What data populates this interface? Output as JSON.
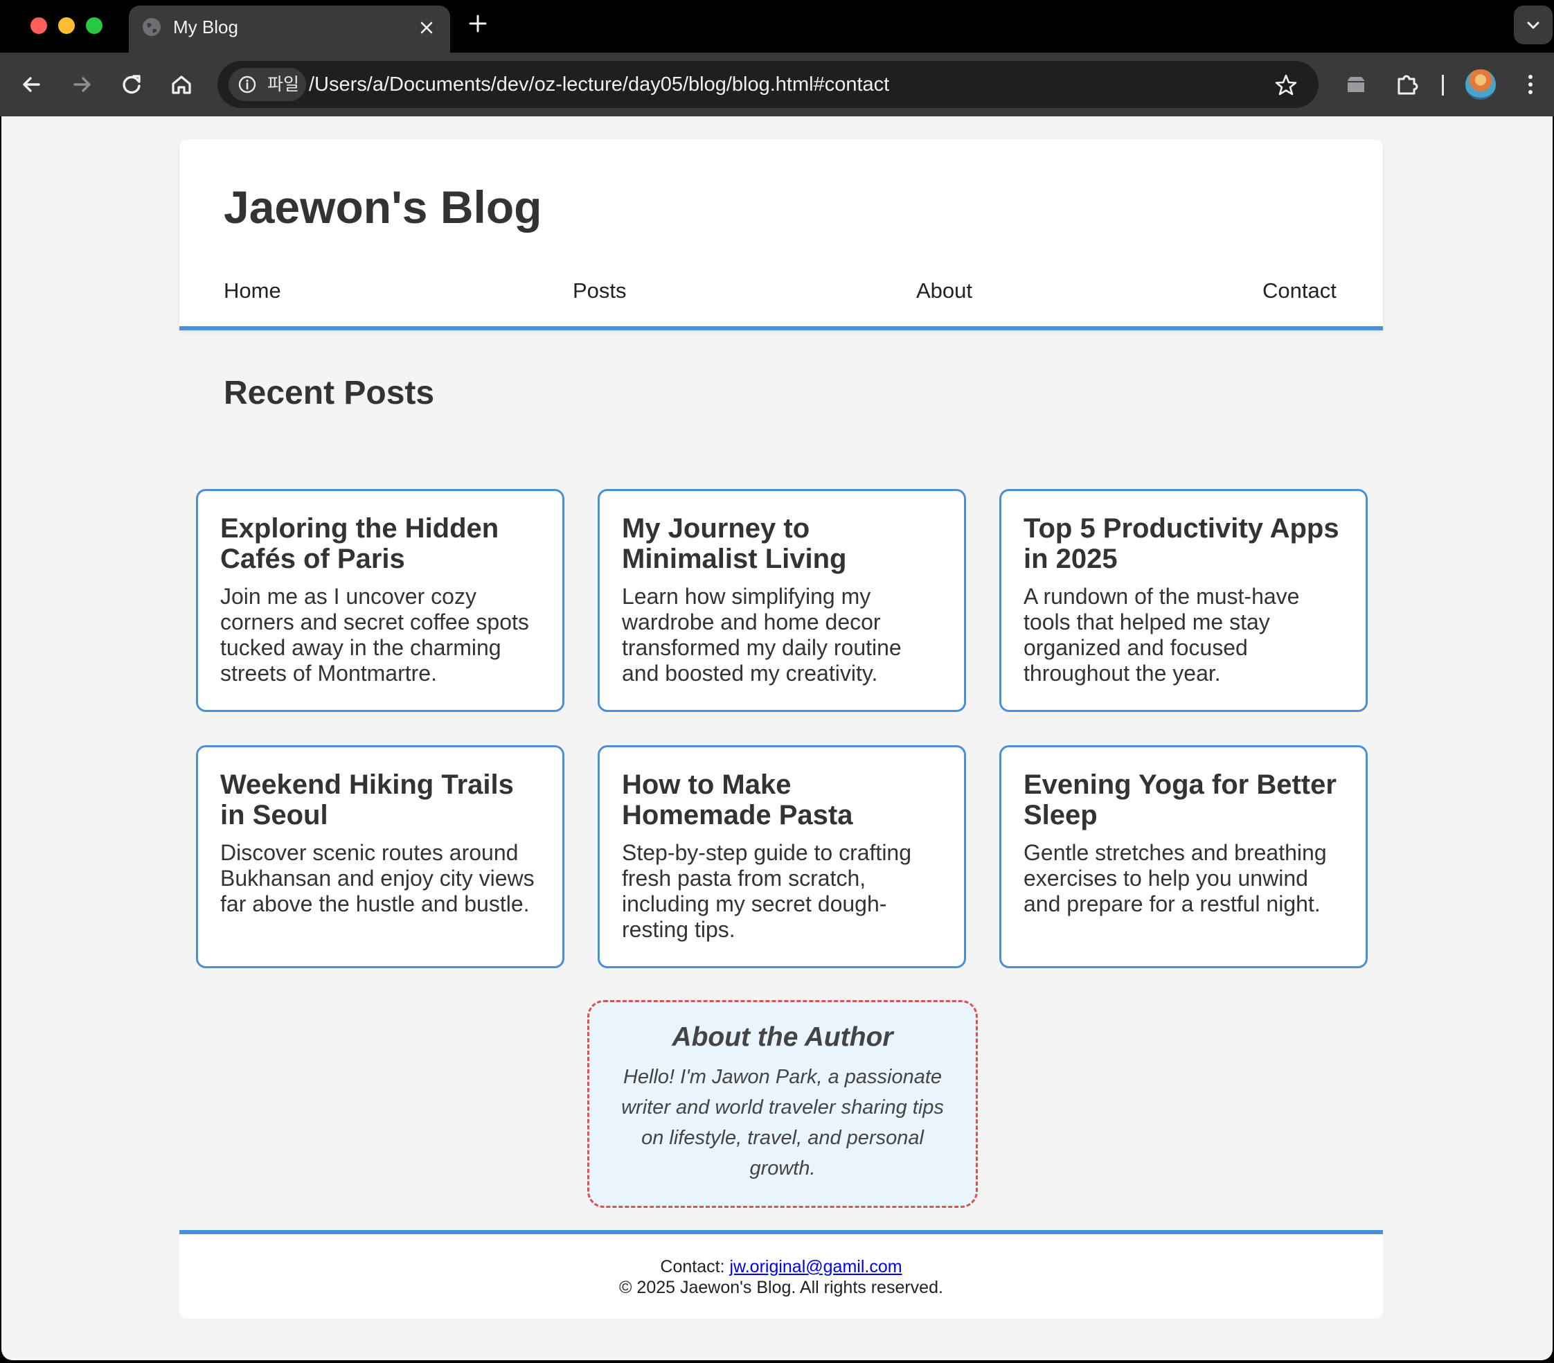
{
  "browser": {
    "tab_title": "My Blog",
    "site_info_label": "파일",
    "url": "/Users/a/Documents/dev/oz-lecture/day05/blog/blog.html#contact"
  },
  "header": {
    "title": "Jaewon's Blog",
    "nav": [
      "Home",
      "Posts",
      "About",
      "Contact"
    ]
  },
  "main": {
    "section_heading": "Recent Posts",
    "posts": [
      {
        "title": "Exploring the Hidden Cafés of Paris",
        "excerpt": "Join me as I uncover cozy corners and secret coffee spots tucked away in the charming streets of Montmartre."
      },
      {
        "title": "My Journey to Minimalist Living",
        "excerpt": "Learn how simplifying my wardrobe and home decor transformed my daily routine and boosted my creativity."
      },
      {
        "title": "Top 5 Productivity Apps in 2025",
        "excerpt": "A rundown of the must-have tools that helped me stay organized and focused throughout the year."
      },
      {
        "title": "Weekend Hiking Trails in Seoul",
        "excerpt": "Discover scenic routes around Bukhansan and enjoy city views far above the hustle and bustle."
      },
      {
        "title": "How to Make Homemade Pasta",
        "excerpt": "Step-by-step guide to crafting fresh pasta from scratch, including my secret dough-resting tips."
      },
      {
        "title": "Evening Yoga for Better Sleep",
        "excerpt": "Gentle stretches and breathing exercises to help you unwind and prepare for a restful night."
      }
    ]
  },
  "author": {
    "heading": "About the Author",
    "bio": "Hello! I'm Jawon Park, a passionate writer and world traveler sharing tips on lifestyle, travel, and personal growth."
  },
  "footer": {
    "contact_label": "Contact:",
    "email": "jw.original@gamil.com",
    "copyright": "© 2025 Jaewon's Blog. All rights reserved."
  },
  "colors": {
    "accent": "#4a90d9",
    "author_border": "#d9534f",
    "author_bg": "#e9f4fd",
    "page_bg": "#f4f4f4"
  }
}
